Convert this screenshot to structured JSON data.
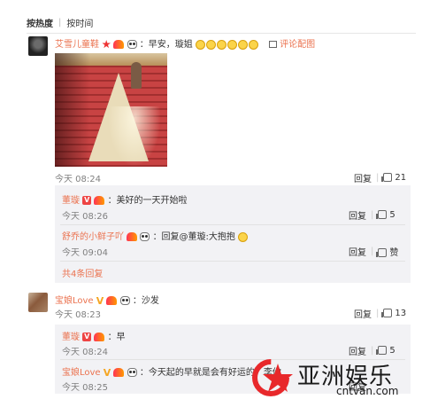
{
  "sort_bar": {
    "hot": "按热度",
    "time": "按时间"
  },
  "comments": [
    {
      "user": "艾雪儿童鞋",
      "text": "：早安，璇姐",
      "eval_pic_label": "评论配图",
      "time": "今天 08:24",
      "reply_label": "回复",
      "like_count": "21",
      "replies": [
        {
          "user": "董璇",
          "text": "：美好的一天开始啦",
          "time": "今天 08:26",
          "reply_label": "回复",
          "like_count": "5"
        },
        {
          "user": "舒乔的小鲜子吖",
          "text": "：回复@董璇:大抱抱",
          "time": "今天 09:04",
          "reply_label": "回复",
          "like_label": "赞"
        }
      ],
      "more_replies": "共4条回复"
    },
    {
      "user": "宝娘Love",
      "text": "：沙发",
      "time": "今天 08:23",
      "reply_label": "回复",
      "like_count": "13",
      "replies": [
        {
          "user": "董璇",
          "text": "：早",
          "time": "今天 08:24",
          "reply_label": "回复",
          "like_count": "5"
        },
        {
          "user": "宝娘Love",
          "text": "：今天起的早就是会有好运的。李你",
          "time": "今天 08:25",
          "reply_label": "回复"
        }
      ]
    }
  ],
  "watermark": {
    "title": "亚洲娱乐",
    "url": "cntvan.com"
  },
  "colors": {
    "name": "#eb7350",
    "time": "#808080",
    "reply_bg": "#f2f2f5"
  }
}
